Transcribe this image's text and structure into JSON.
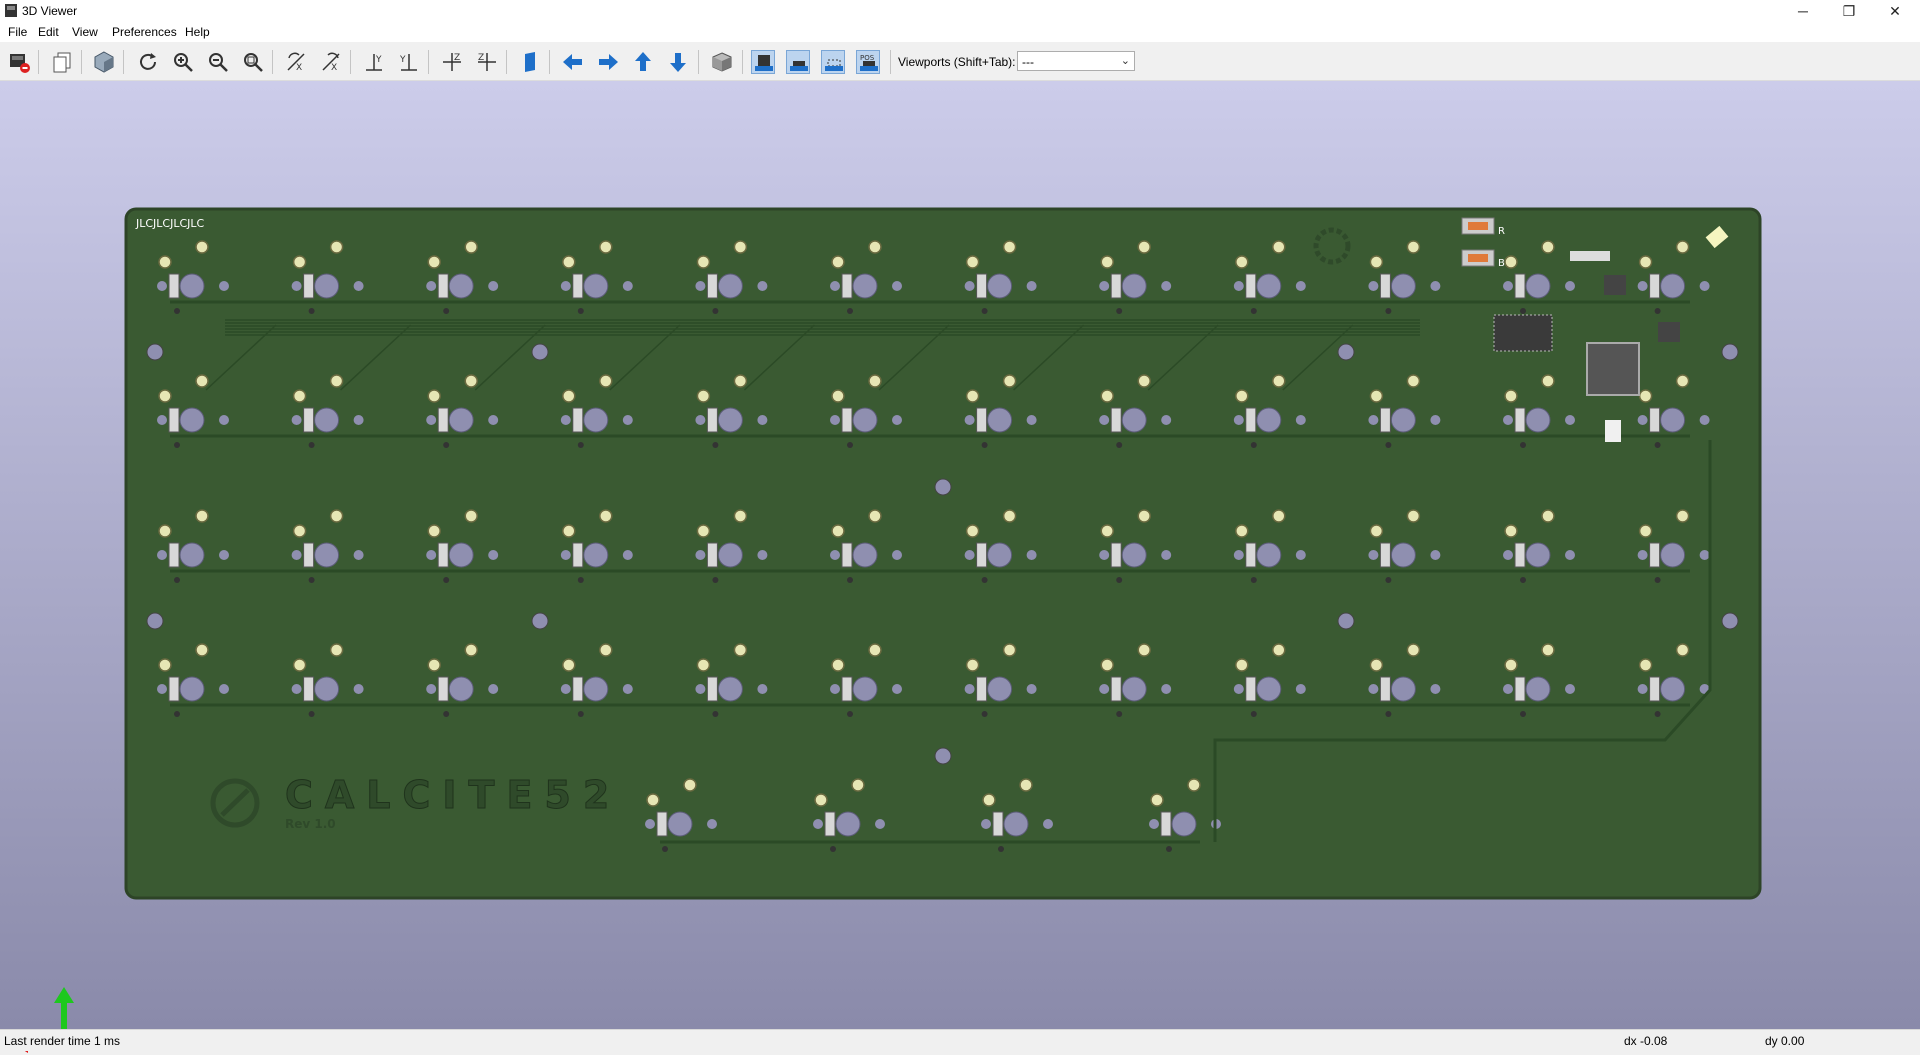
{
  "window": {
    "title": "3D Viewer",
    "minimize": "─",
    "restore": "❐",
    "close": "✕"
  },
  "menu": {
    "items": [
      "File",
      "Edit",
      "View",
      "Preferences",
      "Help"
    ]
  },
  "toolbar": {
    "viewports_label": "Viewports (Shift+Tab):",
    "viewports_value": "---"
  },
  "board": {
    "silkscreen_order_text": "JLCJLCJLCJLC",
    "logo_text": "CALCITE52",
    "rev_text": "Rev 1.0",
    "button_labels": [
      "R",
      "B"
    ],
    "colors": {
      "pcb": "#3a5a32",
      "edge": "#2d4427",
      "track": "#2b4a26",
      "pad": "#e6e6b4",
      "hole": "#8f8fb0",
      "switch": "#d8d8d8"
    }
  },
  "status": {
    "render_time": "Last render time 1 ms",
    "dx": "dx -0.08",
    "dy": "dy 0.00"
  }
}
